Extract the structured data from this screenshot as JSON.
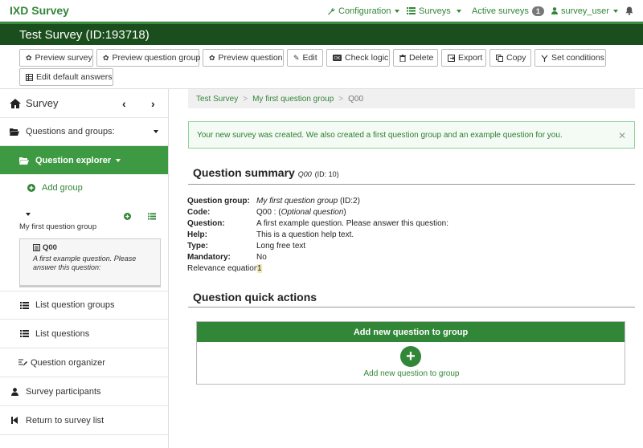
{
  "brand": "IXD Survey",
  "topnav": {
    "configuration": "Configuration",
    "surveys": "Surveys",
    "active_surveys": "Active surveys",
    "active_count": "1",
    "user": "survey_user"
  },
  "survey_title": "Test Survey (ID:193718)",
  "toolbar": {
    "preview_survey": "Preview survey",
    "preview_group": "Preview question group",
    "preview_question": "Preview question",
    "edit": "Edit",
    "check_logic": "Check logic",
    "delete": "Delete",
    "export": "Export",
    "copy": "Copy",
    "set_conditions": "Set conditions",
    "edit_default": "Edit default answers"
  },
  "sidebar": {
    "survey": "Survey",
    "questions_groups": "Questions and groups:",
    "question_explorer": "Question explorer",
    "add_group": "Add group",
    "group_name": "My first question group",
    "question_code": "Q00",
    "question_text": "A first example question. Please answer this question:",
    "list_groups": "List question groups",
    "list_questions": "List questions",
    "organizer": "Question organizer",
    "participants": "Survey participants",
    "return": "Return to survey list"
  },
  "breadcrumb": {
    "survey": "Test Survey",
    "group": "My first question group",
    "question": "Q00"
  },
  "alert": "Your new survey was created. We also created a first question group and an example question for you.",
  "summary": {
    "title": "Question summary",
    "subtitle": "Q00",
    "id_text": "(ID: 10)",
    "rows": [
      {
        "label": "Question group:",
        "value": "My first question group",
        "extra": " (ID:2)"
      },
      {
        "label": "Code:",
        "value": "Q00 : (",
        "extra": "Optional question",
        "tail": ")"
      },
      {
        "label": "Question:",
        "value": "A first example question. Please answer this question:"
      },
      {
        "label": "Help:",
        "value": "This is a question help text."
      },
      {
        "label": "Type:",
        "value": "Long free text"
      },
      {
        "label": "Mandatory:",
        "value": "No"
      }
    ],
    "relevance_label": "Relevance equation:",
    "relevance_value": "1"
  },
  "quick_actions": {
    "title": "Question quick actions",
    "panel_title": "Add new question to group",
    "link": "Add new question to group"
  },
  "colors": {
    "brand_green": "#328637",
    "dark_green": "#1a4f1d",
    "active_green": "#3e9a42"
  }
}
